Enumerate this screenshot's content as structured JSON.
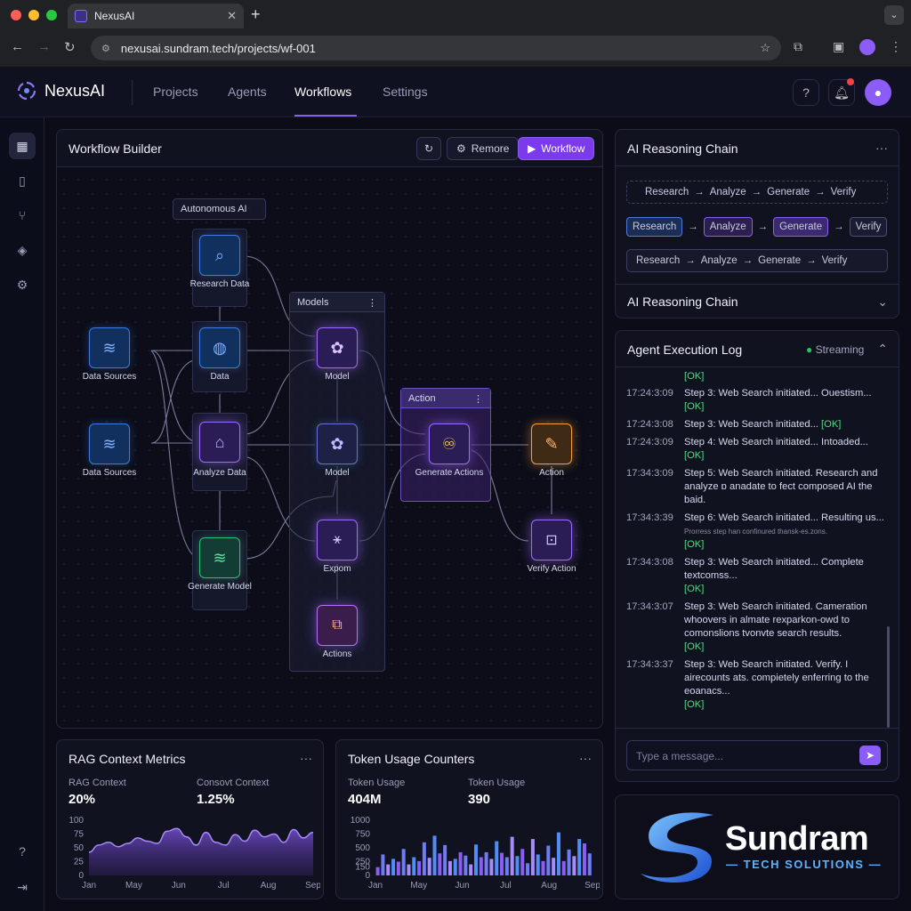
{
  "browser": {
    "tab_title": "NexusAI",
    "url": "nexusai.sundram.tech/projects/wf-001"
  },
  "nav": {
    "logo": "NexusAI",
    "items": [
      "Projects",
      "Agents",
      "Workflows",
      "Settings"
    ],
    "active": "Workflows"
  },
  "builder": {
    "title": "Workflow Builder",
    "btn_remore": "Remore",
    "btn_workflow": "Workflow",
    "groups": {
      "autonomous": "Autonomous AI",
      "models": "Models",
      "action": "Action"
    },
    "nodes": {
      "research_data": "Research Data",
      "data": "Data",
      "data_sources_1": "Data Sources",
      "data_sources_2": "Data Sources",
      "analyze_data": "Analyze Data",
      "generate_model": "Generate Model",
      "model_1": "Model",
      "model_2": "Model",
      "expom": "Expom",
      "actions": "Actions",
      "generate_actions": "Generate Actions",
      "action": "Action",
      "verify_action": "Verify Action"
    }
  },
  "reasoning": {
    "title": "AI Reasoning Chain",
    "steps": [
      "Research",
      "Analyze",
      "Generate",
      "Verify"
    ],
    "title2": "AI  Reasoning Chain"
  },
  "log": {
    "title": "Agent Execution Log",
    "status": "Streaming",
    "placeholder": "Type a message...",
    "top_ok": "[OK]",
    "entries": [
      {
        "time": "17:24:3:09",
        "msg": "Step 3: Web Search initiated... Ouestism...",
        "ok": "[OK]"
      },
      {
        "time": "17:24:3:08",
        "msg": "Step 3: Web Search initiated... ",
        "ok": "[OK]"
      },
      {
        "time": "17:24:3:09",
        "msg": "Step 4: Web Search initiated... Intoaded...",
        "ok": "[OK]"
      },
      {
        "time": "17:34:3:09",
        "msg": "Step 5: Web Search initiated. Research and analyze ɒ anadate to fect composed AI the baid.",
        "ok": ""
      },
      {
        "time": "17:34:3:39",
        "msg": "Step 6: Web Search initiated... Resulting us...",
        "ok": "[OK]",
        "sub": "Prorress step han confinured thansk-es.zons."
      },
      {
        "time": "17:34:3:08",
        "msg": "Step 3: Web Search initiated... Complete textcomss...",
        "ok": "[OK]"
      },
      {
        "time": "17:34:3:07",
        "msg": "Step 3: Web Search initiated. Cameration whoovers in almate rexparkon-owd to comonslions tvonvte search results.",
        "ok": "[OK]"
      },
      {
        "time": "17:34:3:37",
        "msg": "Step 3: Web Search initiated. Verify. I airecounts ats. compietely enferring to the eoanacs...",
        "ok": "[OK]"
      }
    ]
  },
  "rag": {
    "title": "RAG Context Metrics",
    "l1": "RAG Context",
    "v1": "20%",
    "l2": "Consovt Context",
    "v2": "1.25%"
  },
  "tokens": {
    "title": "Token Usage Counters",
    "l1": "Token Usage",
    "v1": "404M",
    "l2": "Token Usage",
    "v2": "390"
  },
  "chart_data": [
    {
      "type": "area",
      "title": "RAG Context Metrics",
      "categories": [
        "Jan",
        "May",
        "Jun",
        "Jul",
        "Aug",
        "Sep"
      ],
      "yticks": [
        100,
        75,
        50,
        25,
        0
      ],
      "ylim": [
        0,
        100
      ],
      "values": [
        42,
        55,
        60,
        52,
        58,
        68,
        62,
        58,
        80,
        85,
        70,
        55,
        78,
        60,
        55,
        74,
        62,
        82,
        70,
        75,
        60,
        83,
        68,
        78
      ]
    },
    {
      "type": "bar",
      "title": "Token Usage Counters",
      "categories": [
        "Jan",
        "May",
        "Jun",
        "Jul",
        "Aug",
        "Sep"
      ],
      "yticks": [
        1000,
        750,
        500,
        250,
        150,
        0
      ],
      "ylim": [
        0,
        1000
      ],
      "values": [
        150,
        380,
        200,
        300,
        250,
        480,
        200,
        330,
        260,
        600,
        320,
        720,
        400,
        550,
        260,
        300,
        420,
        360,
        200,
        560,
        330,
        420,
        300,
        620,
        410,
        330,
        700,
        350,
        480,
        220,
        660,
        380,
        260,
        540,
        320,
        780,
        260,
        470,
        350,
        660,
        580,
        400
      ]
    }
  ],
  "brand": {
    "name": "Sundram",
    "sub": "TECH SOLUTIONS",
    "colors": {
      "blue": "#1e6fe8",
      "light": "#5ab3ff"
    }
  }
}
